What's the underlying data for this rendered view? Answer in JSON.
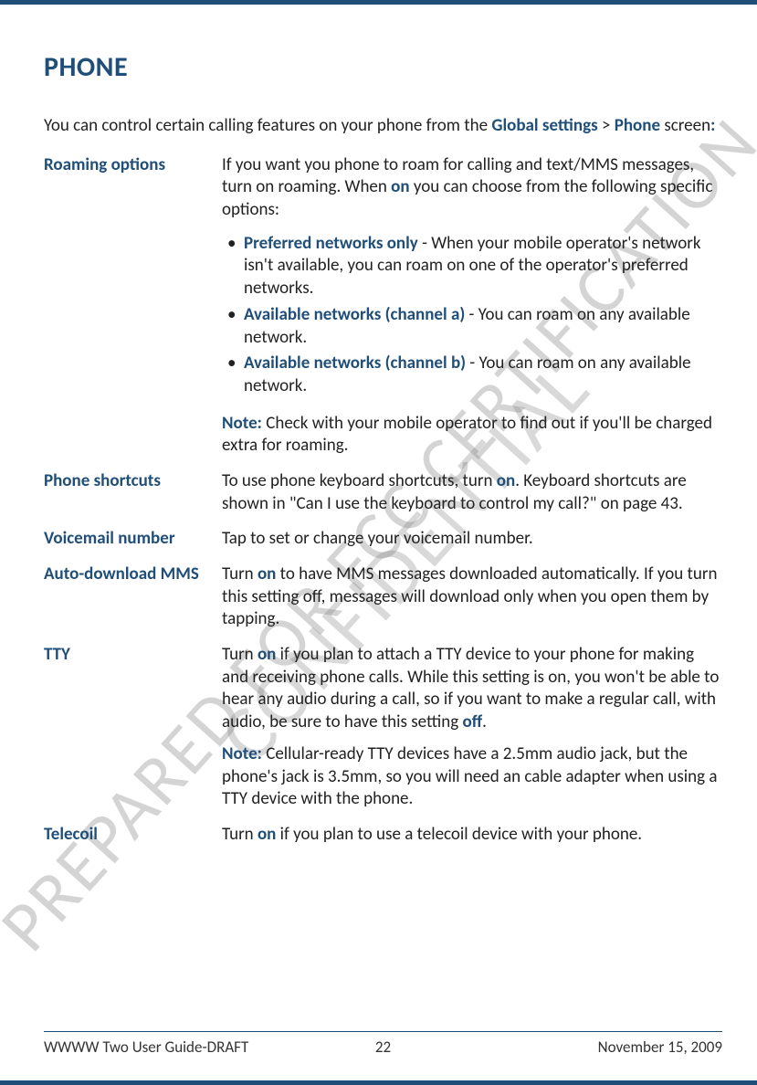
{
  "watermarks": {
    "line1": "PREPARED FOR FCC CERTIFICATION",
    "line2": "CONFIDENTIAL"
  },
  "heading": "PHONE",
  "intro": {
    "pre": "You can control certain calling features on your phone from the ",
    "link1": "Global settings",
    "mid": " > ",
    "link2": "Phone",
    "post1": " screen",
    "colon": ":"
  },
  "rows": {
    "roaming": {
      "term": "Roaming options",
      "lead_pre": "If you want you phone to roam for calling and text/MMS messages, turn on roaming. When ",
      "lead_on": "on",
      "lead_post": " you can choose from the following specific options:",
      "items": [
        {
          "label": "Preferred networks only",
          "desc": " - When your mobile operator's network isn't available, you can roam on one of the operator's preferred networks."
        },
        {
          "label": "Available networks (channel a)",
          "desc": " - You can roam on any available network."
        },
        {
          "label": "Available networks (channel b)",
          "desc": " - You can roam on any available network."
        }
      ],
      "note_label": "Note:",
      "note_text": " Check with your mobile operator to find out if you'll be charged extra for roaming."
    },
    "shortcuts": {
      "term": "Phone shortcuts",
      "pre": "To use phone keyboard shortcuts, turn ",
      "on": "on",
      "post": ". Keyboard shortcuts are shown in \"Can I use the keyboard to control my call?\" on page 43."
    },
    "voicemail": {
      "term": "Voicemail number",
      "text": "Tap to set or change your voicemail number."
    },
    "mms": {
      "term": "Auto-download MMS",
      "pre": "Turn ",
      "on": "on",
      "post": " to have MMS messages downloaded automatically. If you turn this setting off, messages will download only when you open them by tapping."
    },
    "tty": {
      "term": "TTY",
      "p1_pre": "Turn ",
      "p1_on": "on",
      "p1_mid": " if you plan to attach a TTY device to your phone for making and receiving phone calls. While this setting is on, you won't be able to hear any audio during a call, so if you want to make a regular call, with audio, be sure to have this setting ",
      "p1_off": "off",
      "p1_post": ".",
      "note_label": "Note:",
      "note_text": " Cellular-ready TTY devices have a 2.5mm audio jack, but the phone's jack is 3.5mm, so you will need an cable adapter when using a TTY device with the phone."
    },
    "telecoil": {
      "term": "Telecoil",
      "pre": "Turn ",
      "on": "on",
      "post": " if you plan to use a telecoil device with your phone."
    }
  },
  "footer": {
    "left": "WWWW Two User Guide-DRAFT",
    "center": "22",
    "right": "November 15, 2009"
  }
}
